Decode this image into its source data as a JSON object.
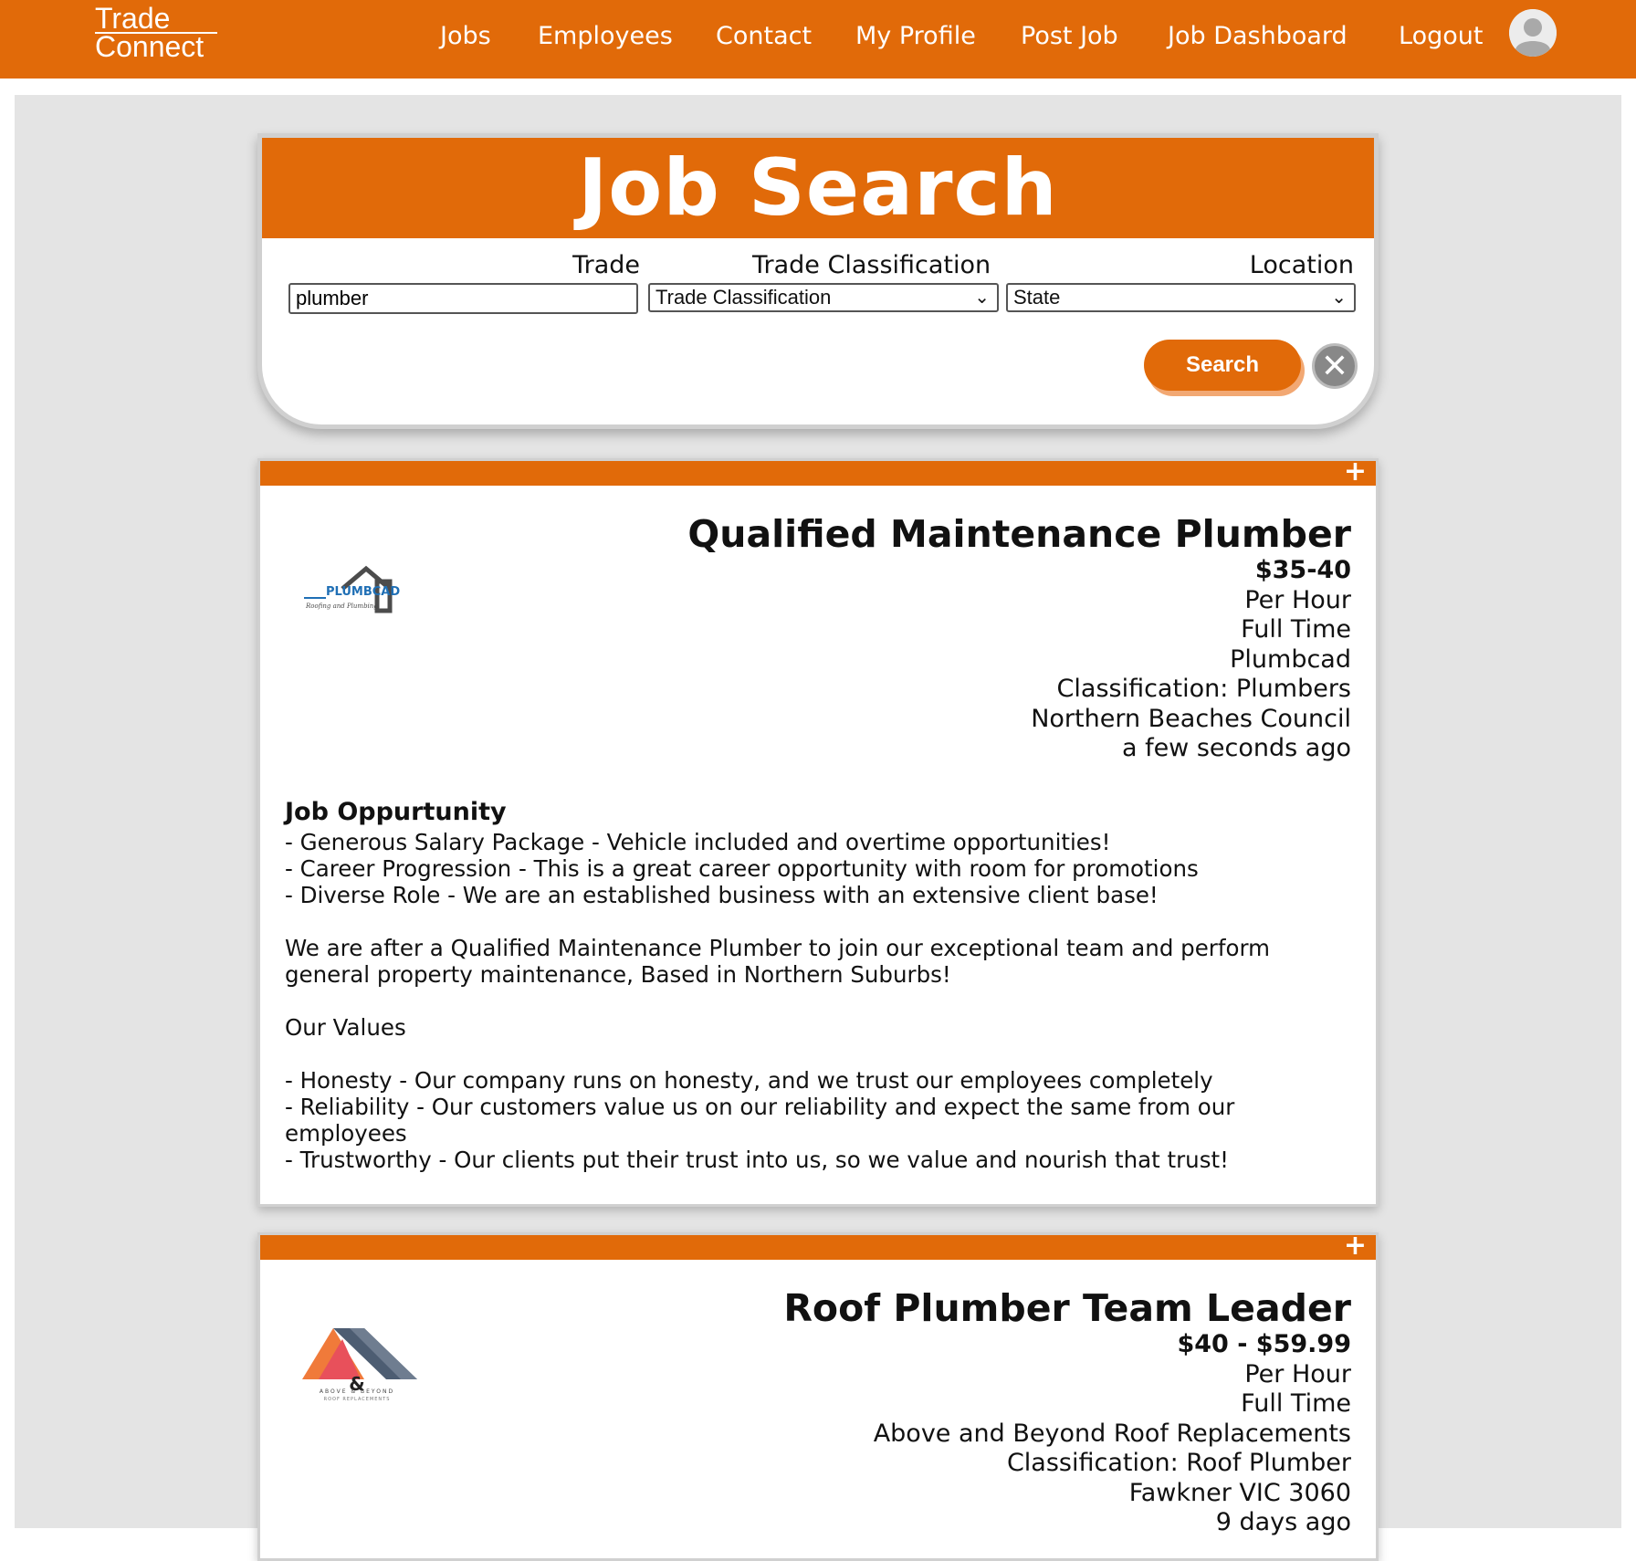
{
  "nav": {
    "logo_line1": "Trade",
    "logo_line2": "Connect",
    "links": [
      "Jobs",
      "Employees",
      "Contact",
      "My Profile",
      "Post Job",
      "Job Dashboard",
      "Logout"
    ]
  },
  "search": {
    "title": "Job Search",
    "trade_label": "Trade",
    "trade_value": "plumber",
    "classification_label": "Trade Classification",
    "classification_selected": "Trade Classification",
    "location_label": "Location",
    "location_selected": "State",
    "search_button": "Search"
  },
  "jobs": [
    {
      "title": "Qualified Maintenance Plumber",
      "pay": "$35-40",
      "pay_type": "Per Hour",
      "employment": "Full Time",
      "company": "Plumbcad",
      "classification": "Classification: Plumbers",
      "location": "Northern Beaches Council",
      "posted": "a few seconds ago",
      "logo_text": "PLUMBCAD",
      "logo_subtext": "Roofing and Plumbing",
      "description_heading": "Job Oppurtunity",
      "description_lines": [
        "- Generous Salary Package - Vehicle included and overtime opportunities!",
        "- Career Progression - This is a great career opportunity with room for promotions",
        "- Diverse Role - We are an established business with an extensive client base!",
        "",
        "We are after a Qualified Maintenance Plumber to join our exceptional team and perform general property maintenance, Based in Northern Suburbs!",
        "",
        "Our Values",
        "",
        "- Honesty - Our company runs on honesty, and we trust our employees completely",
        "- Reliability - Our customers value us on our reliability and expect the same from our employees",
        "- Trustworthy - Our clients put their trust into us, so we value and nourish that trust!"
      ]
    },
    {
      "title": "Roof Plumber Team Leader",
      "pay": "$40 - $59.99",
      "pay_type": "Per Hour",
      "employment": "Full Time",
      "company": "Above and Beyond Roof Replacements",
      "classification": "Classification: Roof Plumber",
      "location": "Fawkner VIC 3060",
      "posted": "9 days ago",
      "logo_text": "ABOVE & BEYOND",
      "logo_subtext": "ROOF REPLACEMENTS"
    }
  ],
  "colors": {
    "brand_orange": "#e16a09",
    "page_gray": "#e4e4e4",
    "clear_gray": "#888888"
  },
  "icons": [
    "avatar-icon",
    "chevron-down-icon",
    "close-icon",
    "plus-icon"
  ]
}
